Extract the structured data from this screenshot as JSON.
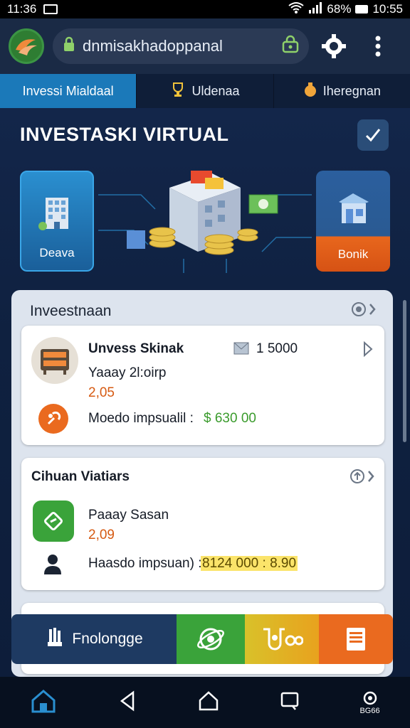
{
  "status": {
    "time": "11:36",
    "battery": "68%",
    "clock": "10:55"
  },
  "browser": {
    "url": "dnmisakhadoppanal"
  },
  "tabs": [
    {
      "label": "Invessi Mialdaal"
    },
    {
      "label": "Uldenaa"
    },
    {
      "label": "Iheregnan"
    }
  ],
  "page": {
    "title": "INVESTASKI VIRTUAL"
  },
  "hero": {
    "left_label": "Deava",
    "right_label": "Bonik"
  },
  "panel": {
    "heading": "Inveestnaan"
  },
  "card1": {
    "title": "Unvess Skinak",
    "amount": "1 5000",
    "subtitle": "Yaaay 2l:oirp",
    "rate": "2,05",
    "impact_label": "Moedo impsualil :",
    "impact_value": "$ 630 00"
  },
  "card2": {
    "title": "Cihuan Viatiars",
    "subtitle": "Paaay Sasan",
    "rate": "2,09",
    "impact_label": "Haasdo impsuan) :",
    "impact_value": "8124 000 : 8.90"
  },
  "bottomnav": {
    "item1_label": "Fnolongge"
  },
  "sysbar": {
    "right_label": "BG66"
  },
  "colors": {
    "accent_blue": "#1b79b9",
    "orange": "#e8671d",
    "green": "#3a9b2c"
  }
}
